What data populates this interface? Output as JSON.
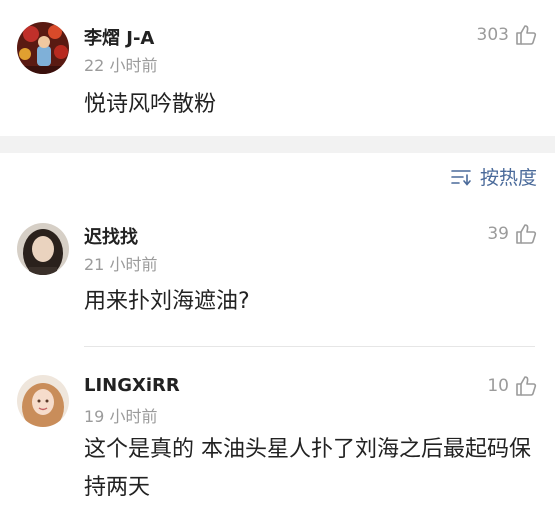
{
  "comments_top": [
    {
      "username": "李熠 J-A",
      "time": "22 小时前",
      "likes": "303",
      "text": "悦诗风吟散粉"
    }
  ],
  "sort": {
    "label": "按热度"
  },
  "comments": [
    {
      "username": "迟找找",
      "time": "21 小时前",
      "likes": "39",
      "text": "用来扑刘海遮油?"
    },
    {
      "username": "LINGXiRR",
      "time": "19 小时前",
      "likes": "10",
      "text": "这个是真的 本油头星人扑了刘海之后最起码保持两天"
    }
  ],
  "icons": {
    "like": "thumbs-up-icon",
    "sort": "sort-lines-icon"
  }
}
